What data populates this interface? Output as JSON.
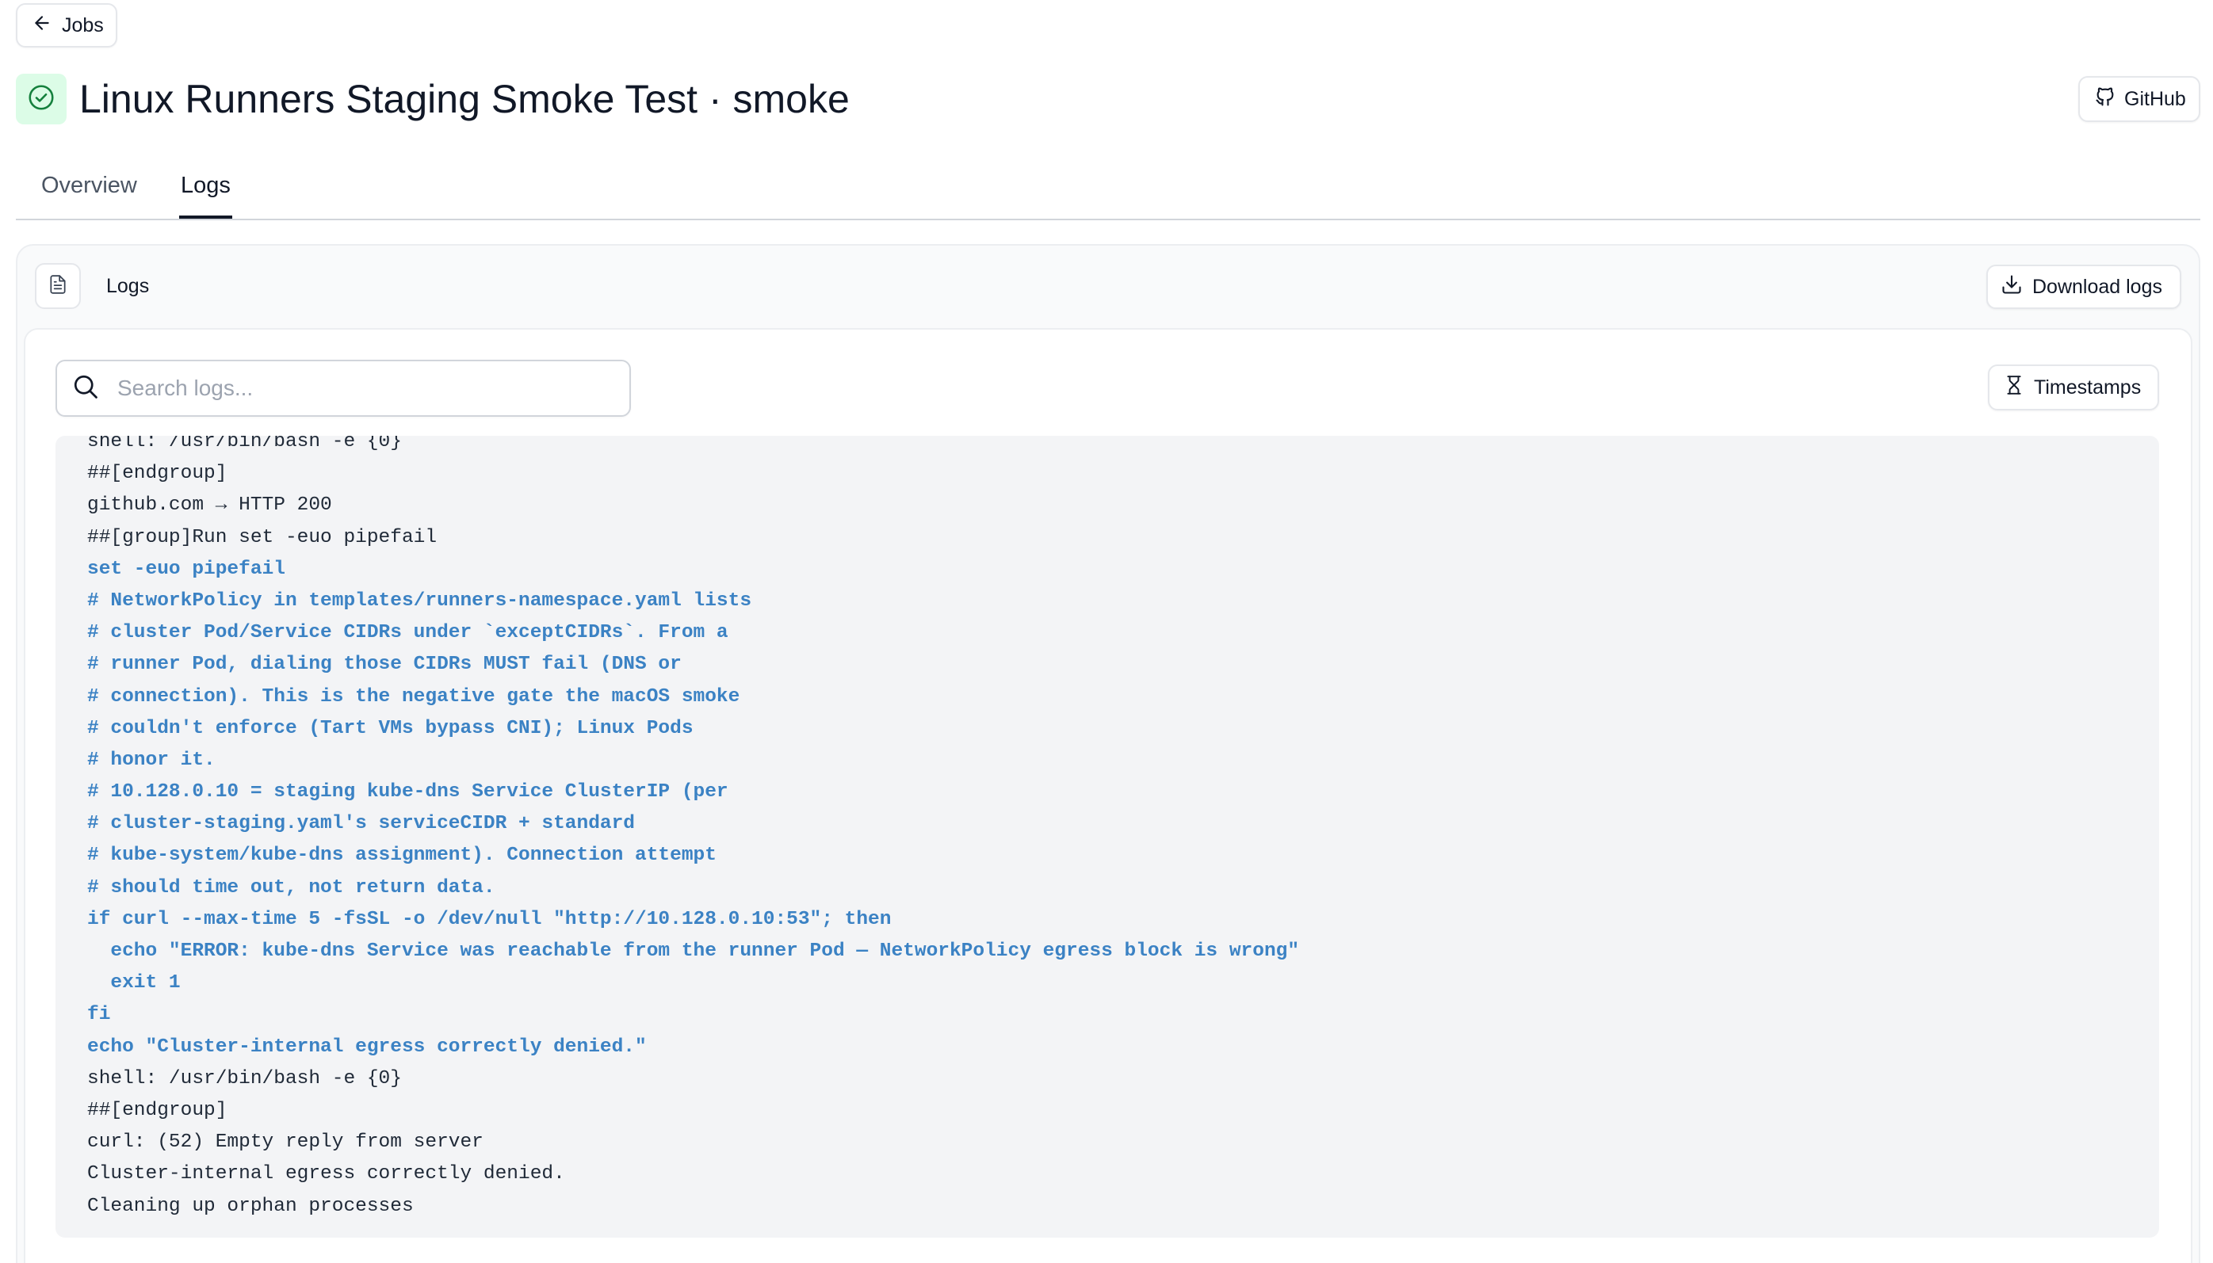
{
  "nav": {
    "back_label": "Jobs"
  },
  "header": {
    "title": "Linux Runners Staging Smoke Test · smoke",
    "status": "success",
    "github_label": "GitHub"
  },
  "tabs": [
    {
      "label": "Overview",
      "active": false
    },
    {
      "label": "Logs",
      "active": true
    }
  ],
  "logs_panel": {
    "title": "Logs",
    "download_label": "Download logs",
    "search": {
      "placeholder": "Search logs...",
      "value": ""
    },
    "timestamps_label": "Timestamps"
  },
  "colors": {
    "success_bg": "#dcfce7",
    "success_icon": "#15803d",
    "command_text": "#3b82c4",
    "output_text": "#1f2937"
  },
  "log_lines": [
    {
      "text": "shell: /usr/bin/bash -e {0}",
      "kind": "output"
    },
    {
      "text": "##[endgroup]",
      "kind": "output"
    },
    {
      "text": "github.com → HTTP 200",
      "kind": "output"
    },
    {
      "text": "##[group]Run set -euo pipefail",
      "kind": "output"
    },
    {
      "text": "set -euo pipefail",
      "kind": "cmd"
    },
    {
      "text": "# NetworkPolicy in templates/runners-namespace.yaml lists",
      "kind": "cmd"
    },
    {
      "text": "# cluster Pod/Service CIDRs under `exceptCIDRs`. From a",
      "kind": "cmd"
    },
    {
      "text": "# runner Pod, dialing those CIDRs MUST fail (DNS or",
      "kind": "cmd"
    },
    {
      "text": "# connection). This is the negative gate the macOS smoke",
      "kind": "cmd"
    },
    {
      "text": "# couldn't enforce (Tart VMs bypass CNI); Linux Pods",
      "kind": "cmd"
    },
    {
      "text": "# honor it.",
      "kind": "cmd"
    },
    {
      "text": "# 10.128.0.10 = staging kube-dns Service ClusterIP (per",
      "kind": "cmd"
    },
    {
      "text": "# cluster-staging.yaml's serviceCIDR + standard",
      "kind": "cmd"
    },
    {
      "text": "# kube-system/kube-dns assignment). Connection attempt",
      "kind": "cmd"
    },
    {
      "text": "# should time out, not return data.",
      "kind": "cmd"
    },
    {
      "text": "if curl --max-time 5 -fsSL -o /dev/null \"http://10.128.0.10:53\"; then",
      "kind": "cmd"
    },
    {
      "text": "  echo \"ERROR: kube-dns Service was reachable from the runner Pod — NetworkPolicy egress block is wrong\"",
      "kind": "cmd"
    },
    {
      "text": "  exit 1",
      "kind": "cmd"
    },
    {
      "text": "fi",
      "kind": "cmd"
    },
    {
      "text": "echo \"Cluster-internal egress correctly denied.\"",
      "kind": "cmd"
    },
    {
      "text": "shell: /usr/bin/bash -e {0}",
      "kind": "output"
    },
    {
      "text": "##[endgroup]",
      "kind": "output"
    },
    {
      "text": "curl: (52) Empty reply from server",
      "kind": "output"
    },
    {
      "text": "Cluster-internal egress correctly denied.",
      "kind": "output"
    },
    {
      "text": "Cleaning up orphan processes",
      "kind": "output"
    }
  ]
}
